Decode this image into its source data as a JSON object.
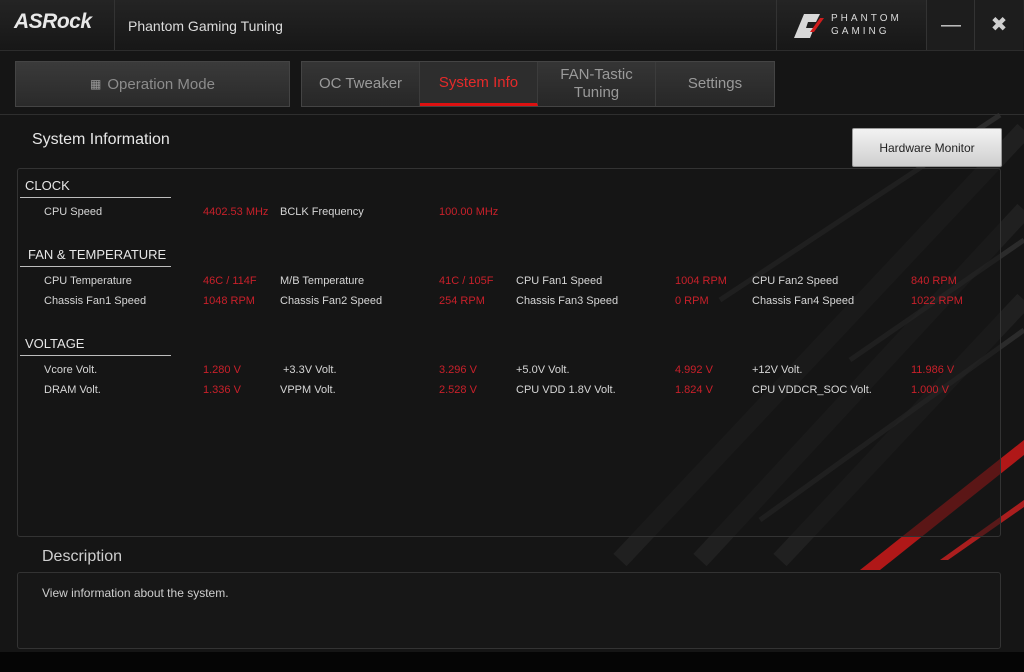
{
  "titlebar": {
    "brand": "ASRock",
    "app_title": "Phantom Gaming Tuning",
    "pg_line1": "PHANTOM",
    "pg_line2": "GAMING",
    "minimize_glyph": "—",
    "close_glyph": "✖",
    "minimize_icon": "minimize-icon",
    "close_icon": "close-icon"
  },
  "nav": {
    "operation_mode": "Operation Mode",
    "operation_mode_icon": "grid-icon",
    "tabs": [
      {
        "label": "OC Tweaker",
        "active": false
      },
      {
        "label": "System Info",
        "active": true
      },
      {
        "label": "FAN-Tastic Tuning",
        "active": false
      },
      {
        "label": "Settings",
        "active": false
      }
    ]
  },
  "main": {
    "section_title": "System Information",
    "hardware_monitor_button": "Hardware Monitor",
    "clock": {
      "title": "CLOCK",
      "cpu_speed_label": "CPU Speed",
      "cpu_speed_value": "4402.53 MHz",
      "bclk_label": "BCLK Frequency",
      "bclk_value": "100.00 MHz"
    },
    "fan_temp": {
      "title": "FAN & TEMPERATURE",
      "cpu_temp_label": "CPU Temperature",
      "cpu_temp_value": "46C / 114F",
      "mb_temp_label": "M/B Temperature",
      "mb_temp_value": "41C / 105F",
      "cpu_fan1_label": "CPU Fan1 Speed",
      "cpu_fan1_value": "1004 RPM",
      "cpu_fan2_label": "CPU Fan2 Speed",
      "cpu_fan2_value": "840 RPM",
      "chassis_fan1_label": "Chassis Fan1 Speed",
      "chassis_fan1_value": "1048 RPM",
      "chassis_fan2_label": "Chassis Fan2 Speed",
      "chassis_fan2_value": "254 RPM",
      "chassis_fan3_label": "Chassis Fan3 Speed",
      "chassis_fan3_value": "0 RPM",
      "chassis_fan4_label": "Chassis Fan4 Speed",
      "chassis_fan4_value": "1022 RPM"
    },
    "voltage": {
      "title": "VOLTAGE",
      "vcore_label": "Vcore Volt.",
      "vcore_value": "1.280 V",
      "v33_label": "+3.3V Volt.",
      "v33_value": "3.296 V",
      "v5_label": "+5.0V Volt.",
      "v5_value": "4.992 V",
      "v12_label": "+12V Volt.",
      "v12_value": "11.986 V",
      "dram_label": "DRAM Volt.",
      "dram_value": "1.336 V",
      "vppm_label": "VPPM Volt.",
      "vppm_value": "2.528 V",
      "cpu_vdd18_label": "CPU VDD 1.8V Volt.",
      "cpu_vdd18_value": "1.824 V",
      "cpu_vddcr_soc_label": "CPU VDDCR_SOC Volt.",
      "cpu_vddcr_soc_value": "1.000 V"
    }
  },
  "description": {
    "title": "Description",
    "text": "View information about the system."
  },
  "colors": {
    "accent_red": "#c8202a",
    "active_tab_red": "#e52a2a",
    "background": "#151515"
  }
}
